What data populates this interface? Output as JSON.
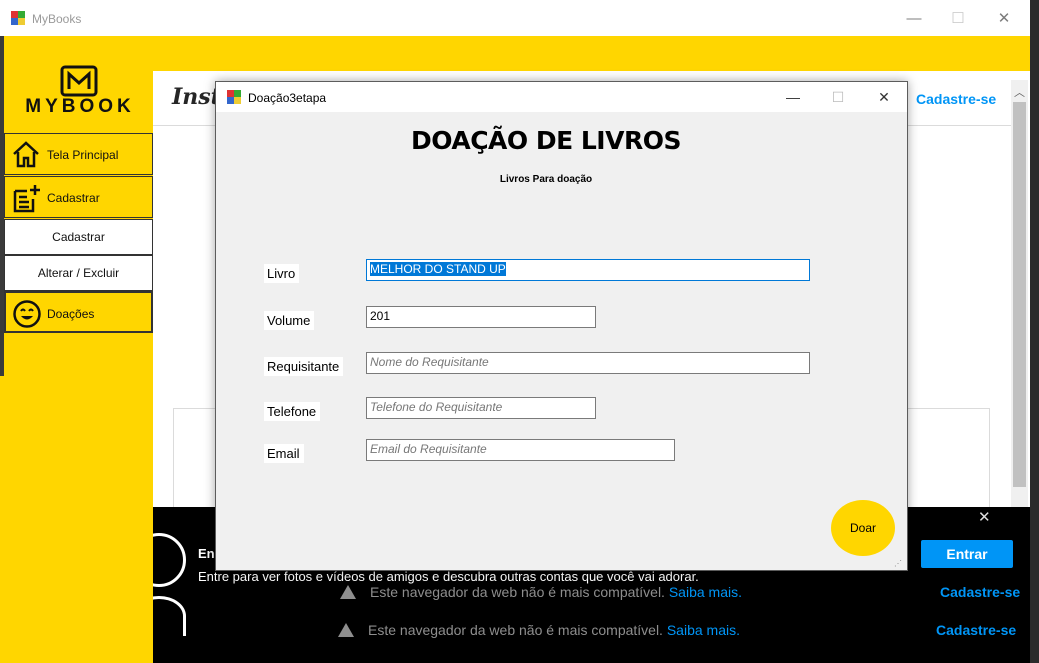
{
  "main_window": {
    "title": "MyBooks",
    "minimize": "—",
    "maximize": "☐",
    "close": "✕"
  },
  "sidebar": {
    "logo_text": "MYBOOK",
    "items": [
      {
        "label": "Tela Principal",
        "icon": "home-icon"
      },
      {
        "label": "Cadastrar",
        "icon": "note-add-icon"
      },
      {
        "label": "Cadastrar",
        "icon": ""
      },
      {
        "label": "Alterar / Excluir",
        "icon": ""
      },
      {
        "label": "Doações",
        "icon": "smiley-icon"
      }
    ]
  },
  "browser": {
    "brand_partial": "Inst",
    "cadastre_top": "Cadastre-se",
    "banner_title_partial": "En",
    "banner_text": "Entre para ver fotos e vídeos de amigos e descubra outras contas que você vai adorar.",
    "entrar_label": "Entrar",
    "banner_close": "✕",
    "warning_text": "Este navegador da web não é mais compatível.",
    "warning_link": "Saiba mais.",
    "cadastre_bottom": "Cadastre-se"
  },
  "dialog": {
    "title": "Doação3etapa",
    "heading": "DOAÇÃO DE LIVROS",
    "subheading": "Livros Para doação",
    "fields": {
      "livro": {
        "label": "Livro",
        "value": "MELHOR DO STAND UP"
      },
      "volume": {
        "label": "Volume",
        "value": "201"
      },
      "requisitante": {
        "label": "Requisitante",
        "placeholder": "Nome do Requisitante"
      },
      "telefone": {
        "label": "Telefone",
        "placeholder": "Telefone do Requisitante"
      },
      "email": {
        "label": "Email",
        "placeholder": "Email do Requisitante"
      }
    },
    "doar_label": "Doar",
    "minimize": "—",
    "maximize": "☐",
    "close": "✕"
  },
  "colors": {
    "accent_yellow": "#ffd600",
    "link_blue": "#0095f6",
    "selection_blue": "#0078d7"
  }
}
